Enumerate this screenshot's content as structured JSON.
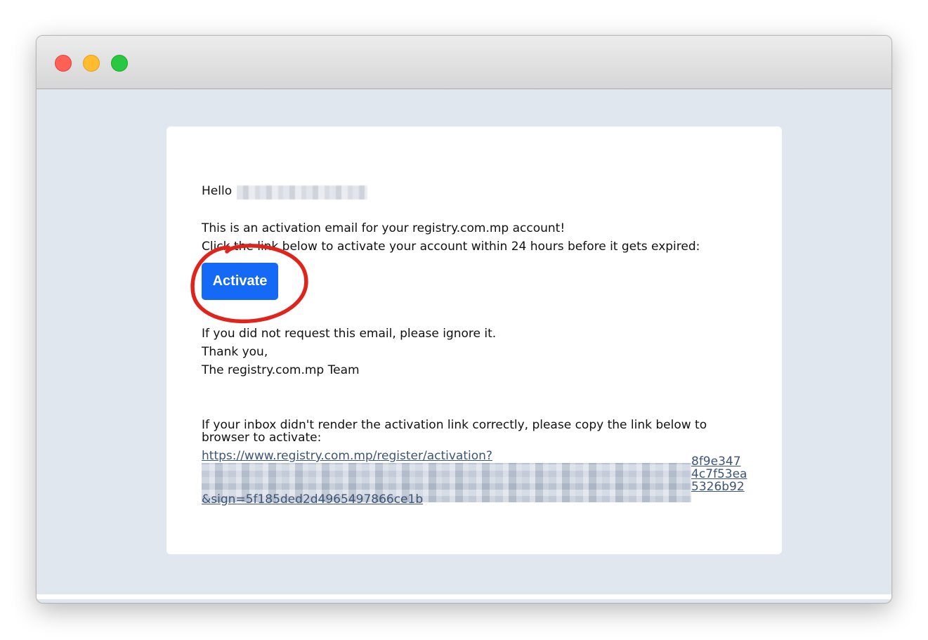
{
  "window": {
    "buttons": [
      "close",
      "minimize",
      "maximize"
    ]
  },
  "email": {
    "greeting": "Hello",
    "intro": "This is an activation email for your registry.com.mp account!",
    "instruction": "Click the link below to activate your account within 24 hours before it gets expired:",
    "activate_label": "Activate",
    "ignore_note": "If you did not request this email, please ignore it.",
    "thanks": "Thank you,",
    "signature": "The registry.com.mp Team",
    "fallback_line1": "If your inbox didn't render the activation link correctly, please copy the link below to",
    "fallback_line2": "browser to activate:",
    "link_line1": "https://www.registry.com.mp/register/activation?",
    "link_tail1": "8f9e347",
    "link_tail2": "4c7f53ea",
    "link_tail3": "5326b92",
    "link_last": "&sign=5f185ded2d4965497866ce1b"
  },
  "colors": {
    "button": "#1469f7",
    "annotation_circle": "#e0241b",
    "link": "#3d5575",
    "background": "#e0e7ef"
  }
}
